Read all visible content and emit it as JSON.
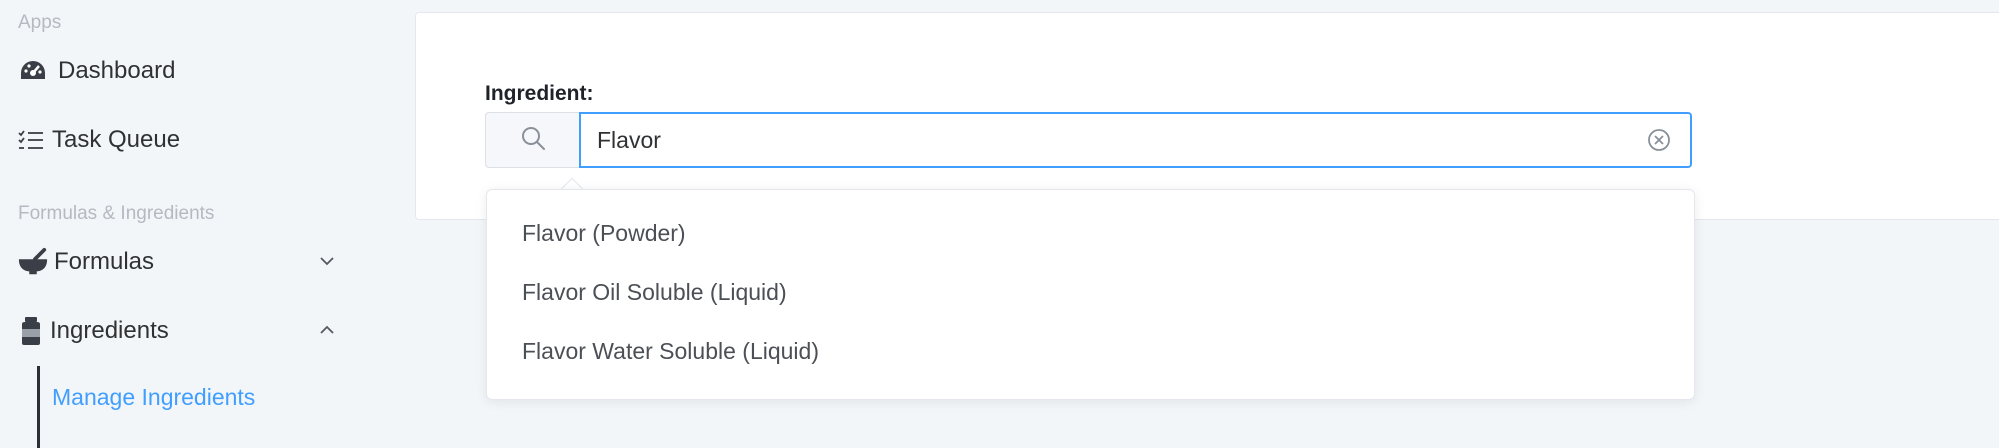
{
  "sidebar": {
    "apps_label": "Apps",
    "formulas_section_label": "Formulas & Ingredients",
    "items": [
      {
        "label": "Dashboard",
        "icon": "dashboard-gauge-icon"
      },
      {
        "label": "Task Queue",
        "icon": "task-list-icon"
      },
      {
        "label": "Formulas",
        "icon": "mortar-pestle-icon",
        "expanded": false
      },
      {
        "label": "Ingredients",
        "icon": "jar-icon",
        "expanded": true
      }
    ],
    "subitems": [
      {
        "label": "Manage Ingredients",
        "active": true
      }
    ]
  },
  "form": {
    "ingredient_label": "Ingredient:",
    "search_value": "Flavor",
    "search_icon": "search-icon",
    "clear_icon": "circle-close-icon"
  },
  "dropdown": {
    "options": [
      {
        "label": "Flavor (Powder)"
      },
      {
        "label": "Flavor Oil Soluble (Liquid)"
      },
      {
        "label": "Flavor Water Soluble (Liquid)"
      }
    ]
  },
  "colors": {
    "accent": "#409eff",
    "sidebar_text": "#303133",
    "section_label": "#b4bac2",
    "background": "#f3f6f9"
  }
}
